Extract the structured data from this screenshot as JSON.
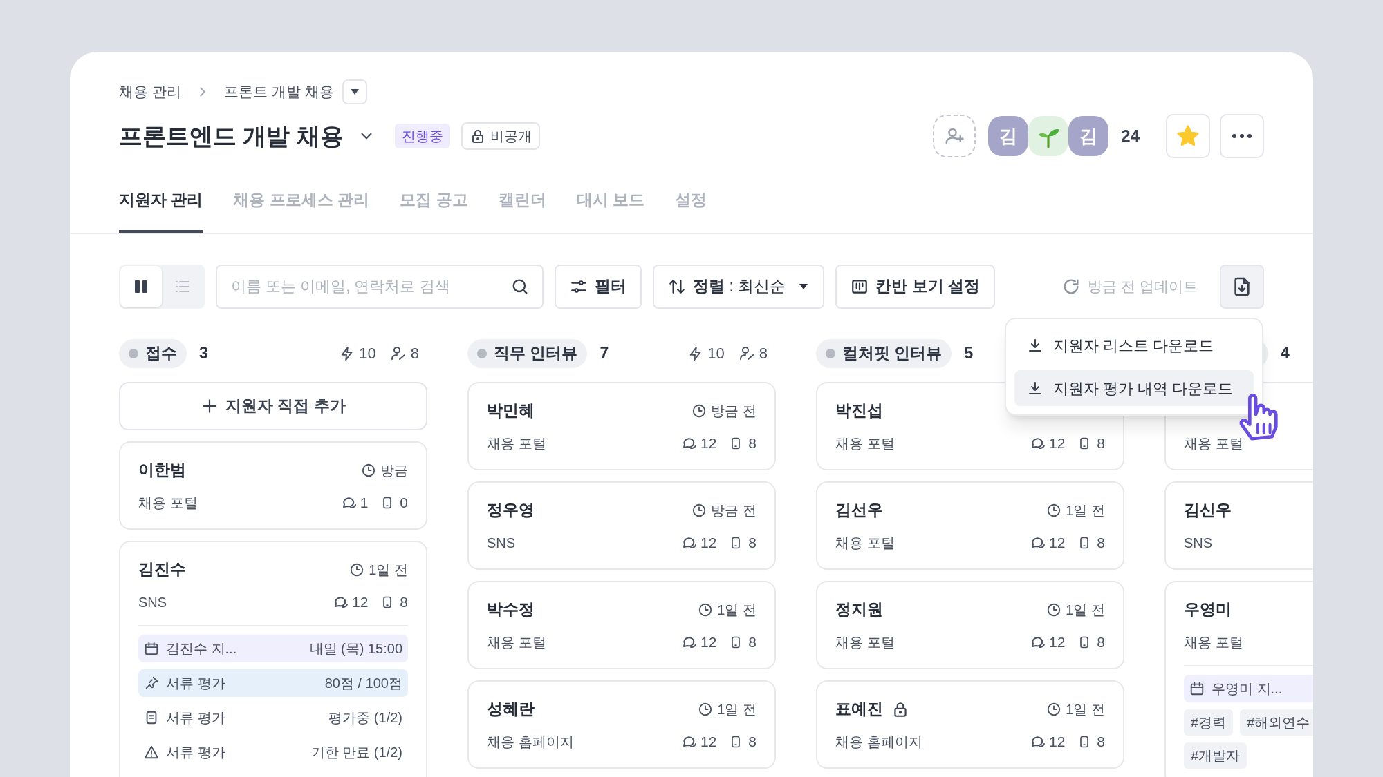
{
  "breadcrumb": [
    "채용 관리",
    "프론트 개발 채용"
  ],
  "title": "프론트엔드 개발 채용",
  "status_badge": "진행중",
  "visibility": "비공개",
  "members": {
    "avatars": [
      {
        "kind": "initial",
        "text": "김"
      },
      {
        "kind": "sprout"
      },
      {
        "kind": "initial",
        "text": "김"
      }
    ],
    "count": "24"
  },
  "favorite": {
    "starred": true
  },
  "tabs": [
    {
      "label": "지원자 관리",
      "selected": true
    },
    {
      "label": "채용 프로세스 관리",
      "selected": false
    },
    {
      "label": "모집 공고",
      "selected": false
    },
    {
      "label": "캘린더",
      "selected": false
    },
    {
      "label": "대시 보드",
      "selected": false
    },
    {
      "label": "설정",
      "selected": false
    }
  ],
  "toolbar": {
    "views": [
      {
        "kind": "kanban",
        "selected": true
      },
      {
        "kind": "list",
        "selected": false
      }
    ],
    "search": {
      "placeholder": "이름 또는 이메일, 연락처로 검색"
    },
    "filter": "필터",
    "sort": "**정렬** : 최신순",
    "kanban_settings": "칸반 보기 설정",
    "updated": "방금 전 업데이트"
  },
  "download_menu": [
    {
      "label": "지원자 리스트 다운로드",
      "selected": false
    },
    {
      "label": "지원자 평가 내역 다운로드",
      "selected": true
    }
  ],
  "columns": [
    {
      "title": "접수",
      "count": "3",
      "bolts": "10",
      "assignees": "8",
      "add_button": "지원자 직접 추가",
      "cards": [
        {
          "name": "이한범",
          "locked": false,
          "time": "방금",
          "source": "채용 포털",
          "comments": "1",
          "attachments": "0"
        },
        {
          "name": "김진수",
          "locked": false,
          "time": "1일 전",
          "source": "SNS",
          "comments": "12",
          "attachments": "8",
          "activities": [
            {
              "kind": "schedule",
              "label": "김진수 지...",
              "value": "내일 (목) 15:00"
            },
            {
              "kind": "score",
              "label": "서류 평가",
              "value": "80점 / 100점"
            },
            {
              "kind": "document",
              "label": "서류 평가",
              "value": "평가중 (1/2)"
            },
            {
              "kind": "warning",
              "label": "서류 평가",
              "value": "기한 만료 (1/2)"
            }
          ]
        }
      ]
    },
    {
      "title": "직무 인터뷰",
      "count": "7",
      "bolts": "10",
      "assignees": "8",
      "cards": [
        {
          "name": "박민혜",
          "locked": false,
          "time": "방금 전",
          "source": "채용 포털",
          "comments": "12",
          "attachments": "8"
        },
        {
          "name": "정우영",
          "locked": false,
          "time": "방금 전",
          "source": "SNS",
          "comments": "12",
          "attachments": "8"
        },
        {
          "name": "박수정",
          "locked": false,
          "time": "1일 전",
          "source": "채용 포털",
          "comments": "12",
          "attachments": "8"
        },
        {
          "name": "성혜란",
          "locked": false,
          "time": "1일 전",
          "source": "채용 홈페이지",
          "comments": "12",
          "attachments": "8"
        }
      ]
    },
    {
      "title": "컬처핏 인터뷰",
      "count": "5",
      "cards": [
        {
          "name": "박진섭",
          "locked": false,
          "source": "채용 포털",
          "comments": "12",
          "attachments": "8"
        },
        {
          "name": "김선우",
          "locked": false,
          "time": "1일 전",
          "source": "채용 포털",
          "comments": "12",
          "attachments": "8"
        },
        {
          "name": "정지원",
          "locked": false,
          "time": "1일 전",
          "source": "채용 포털",
          "comments": "12",
          "attachments": "8"
        },
        {
          "name": "표예진",
          "locked": true,
          "time": "1일 전",
          "source": "채용 홈페이지",
          "comments": "12",
          "attachments": "8"
        }
      ]
    },
    {
      "count": "4",
      "cards": [
        {
          "locked": false,
          "source": "채용 포털"
        },
        {
          "name": "김신우",
          "locked": false,
          "source": "SNS"
        },
        {
          "name": "우영미",
          "locked": false,
          "source": "채용 포털",
          "activities": [
            {
              "kind": "schedule",
              "label": "우영미 지..."
            }
          ],
          "tags": [
            "#경력",
            "#해외연수",
            "#개발자"
          ]
        }
      ]
    }
  ]
}
